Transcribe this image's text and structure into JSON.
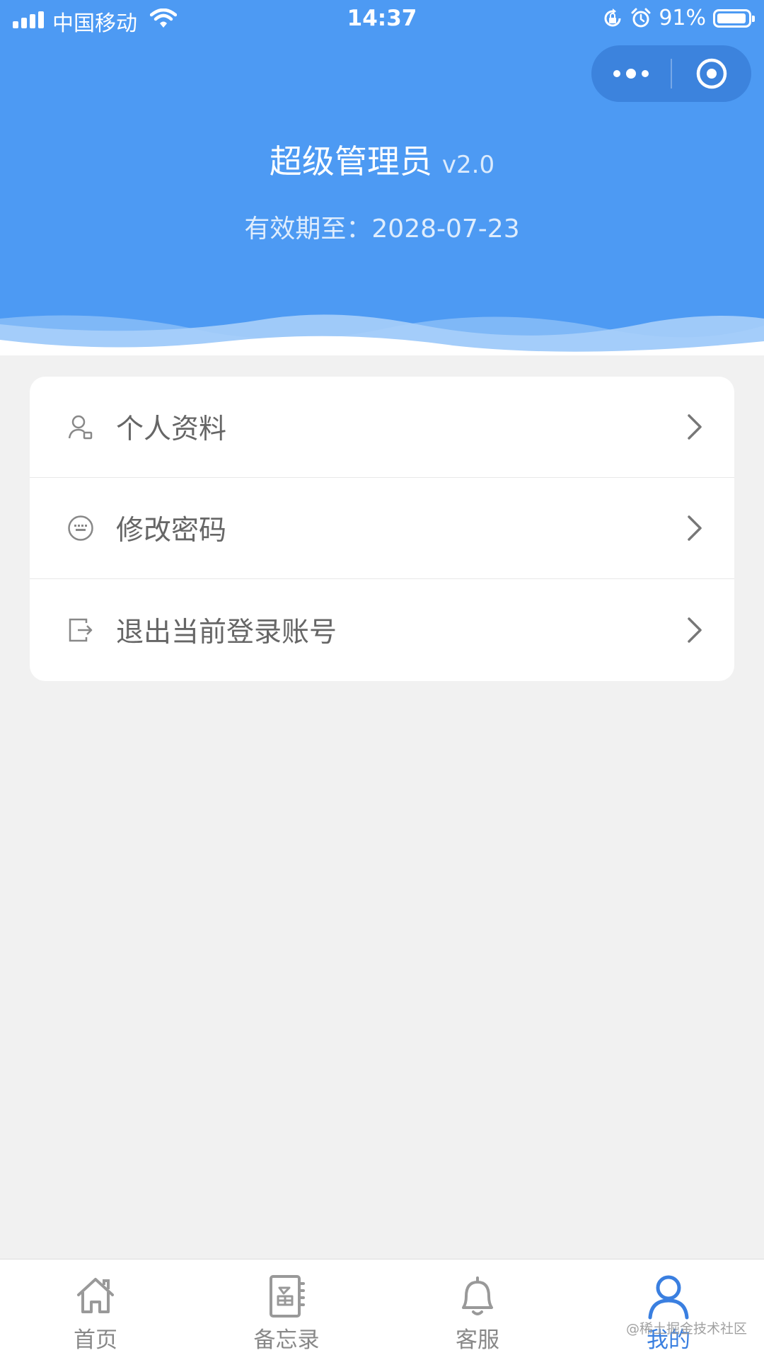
{
  "status_bar": {
    "carrier": "中国移动",
    "time": "14:37",
    "battery": "91%"
  },
  "header": {
    "title": "超级管理员",
    "version": "v2.0",
    "expiry_label": "有效期至：",
    "expiry_date": "2028-07-23"
  },
  "menu": {
    "items": [
      {
        "label": "个人资料",
        "icon": "user-profile-icon"
      },
      {
        "label": "修改密码",
        "icon": "keyboard-icon"
      },
      {
        "label": "退出当前登录账号",
        "icon": "logout-icon"
      }
    ]
  },
  "tab_bar": {
    "tabs": [
      {
        "label": "首页",
        "icon": "home-icon"
      },
      {
        "label": "备忘录",
        "icon": "memo-icon"
      },
      {
        "label": "客服",
        "icon": "bell-icon"
      },
      {
        "label": "我的",
        "icon": "user-icon",
        "active": true
      }
    ]
  },
  "watermark": "@稀土掘金技术社区",
  "colors": {
    "header_blue": "#4d9af3",
    "active_tab": "#3a7fe0",
    "page_bg": "#f1f1f1"
  }
}
